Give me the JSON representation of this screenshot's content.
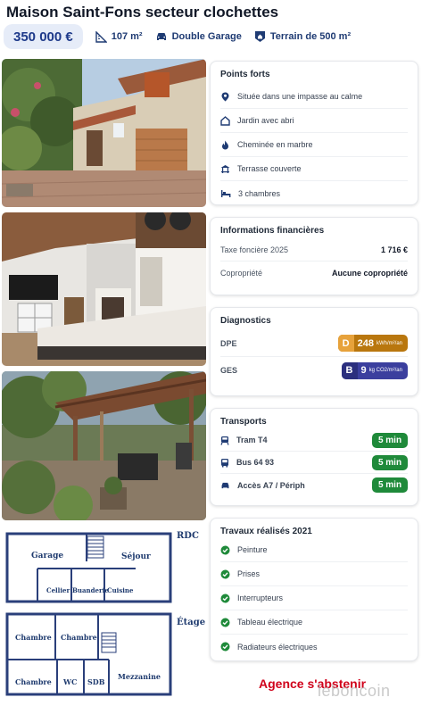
{
  "listing": {
    "title": "Maison Saint-Fons secteur clochettes",
    "price": "350 000 €",
    "surface": "107 m²",
    "garage": "Double Garage",
    "terrain": "Terrain de 500 m²"
  },
  "highlights": {
    "title": "Points forts",
    "items": [
      {
        "label": "Située dans une impasse au calme",
        "icon": "location-pin-icon"
      },
      {
        "label": "Jardin avec abri",
        "icon": "house-icon"
      },
      {
        "label": "Cheminée en marbre",
        "icon": "flame-icon"
      },
      {
        "label": "Terrasse couverte",
        "icon": "terrace-icon"
      },
      {
        "label": "3 chambres",
        "icon": "bed-icon"
      }
    ]
  },
  "finance": {
    "title": "Informations financières",
    "rows": [
      {
        "label": "Taxe foncière 2025",
        "value": "1 716 €"
      },
      {
        "label": "Copropriété",
        "value": "Aucune copropriété"
      }
    ]
  },
  "diagnostics": {
    "title": "Diagnostics",
    "dpe": {
      "label": "DPE",
      "class": "D",
      "value": "248",
      "unit": "kWh/m²/an",
      "color": "#b9770e"
    },
    "ges": {
      "label": "GES",
      "class": "B",
      "value": "9",
      "unit": "kg CO2/m²/an",
      "color": "#3b3f9e"
    }
  },
  "transports": {
    "title": "Transports",
    "items": [
      {
        "label": "Tram T4",
        "time": "5 min",
        "icon": "tram-icon"
      },
      {
        "label": "Bus 64 93",
        "time": "5 min",
        "icon": "bus-icon"
      },
      {
        "label": "Accès A7 / Périph",
        "time": "5 min",
        "icon": "car-icon"
      }
    ]
  },
  "works": {
    "title": "Travaux réalisés 2021",
    "items": [
      {
        "label": "Peinture"
      },
      {
        "label": "Prises"
      },
      {
        "label": "Interrupteurs"
      },
      {
        "label": "Tableau électrique"
      },
      {
        "label": "Radiateurs électriques"
      }
    ]
  },
  "floorplan": {
    "rdc": "RDC",
    "etage": "Étage",
    "rooms": [
      "Garage",
      "Séjour",
      "Cellier",
      "Buanderie",
      "Cuisine",
      "Chambre",
      "Chambre",
      "Chambre",
      "WC",
      "SDB",
      "Mezzanine"
    ]
  },
  "footer": {
    "agency": "Agence s'abstenir",
    "watermark": "leboncoin"
  },
  "colors": {
    "accent": "#1e3a8a",
    "green": "#1f8a3a",
    "red": "#d0021b"
  }
}
